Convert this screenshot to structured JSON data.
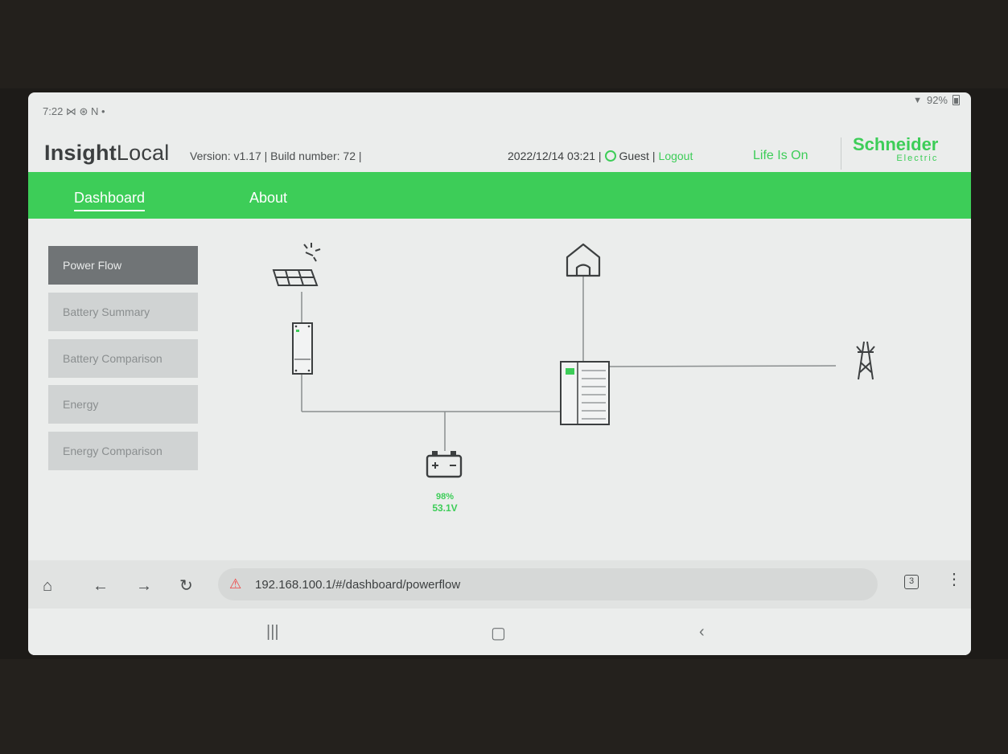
{
  "status_bar": {
    "time_icons": "7:22 ⋈ ⊛ N •",
    "battery": "92%"
  },
  "header": {
    "brand_bold": "Insight",
    "brand_light": "Local",
    "version": "Version: v1.17 | Build number: 72 |",
    "datetime": "2022/12/14 03:21 |",
    "user": "Guest",
    "separator": "|",
    "logout": "Logout",
    "tagline": "Life Is On",
    "logo_line1": "Schneider",
    "logo_line2": "Electric"
  },
  "nav": {
    "tabs": [
      {
        "label": "Dashboard",
        "active": true
      },
      {
        "label": "About",
        "active": false
      }
    ]
  },
  "sidebar": {
    "items": [
      {
        "label": "Power Flow",
        "active": true
      },
      {
        "label": "Battery Summary"
      },
      {
        "label": "Battery Comparison"
      },
      {
        "label": "Energy"
      },
      {
        "label": "Energy Comparison"
      }
    ]
  },
  "powerflow": {
    "nodes": [
      "sun-icon",
      "solar-panel-icon",
      "charge-controller-icon",
      "home-icon",
      "inverter-icon",
      "grid-tower-icon",
      "battery-icon"
    ],
    "battery": {
      "percent": "98%",
      "voltage": "53.1V"
    }
  },
  "browser": {
    "url": "192.168.100.1/#/dashboard/powerflow",
    "tab_count": "3"
  },
  "colors": {
    "accent": "#3dcd58",
    "sidebar_active": "#707476",
    "sidebar_inactive": "#d0d3d3"
  }
}
